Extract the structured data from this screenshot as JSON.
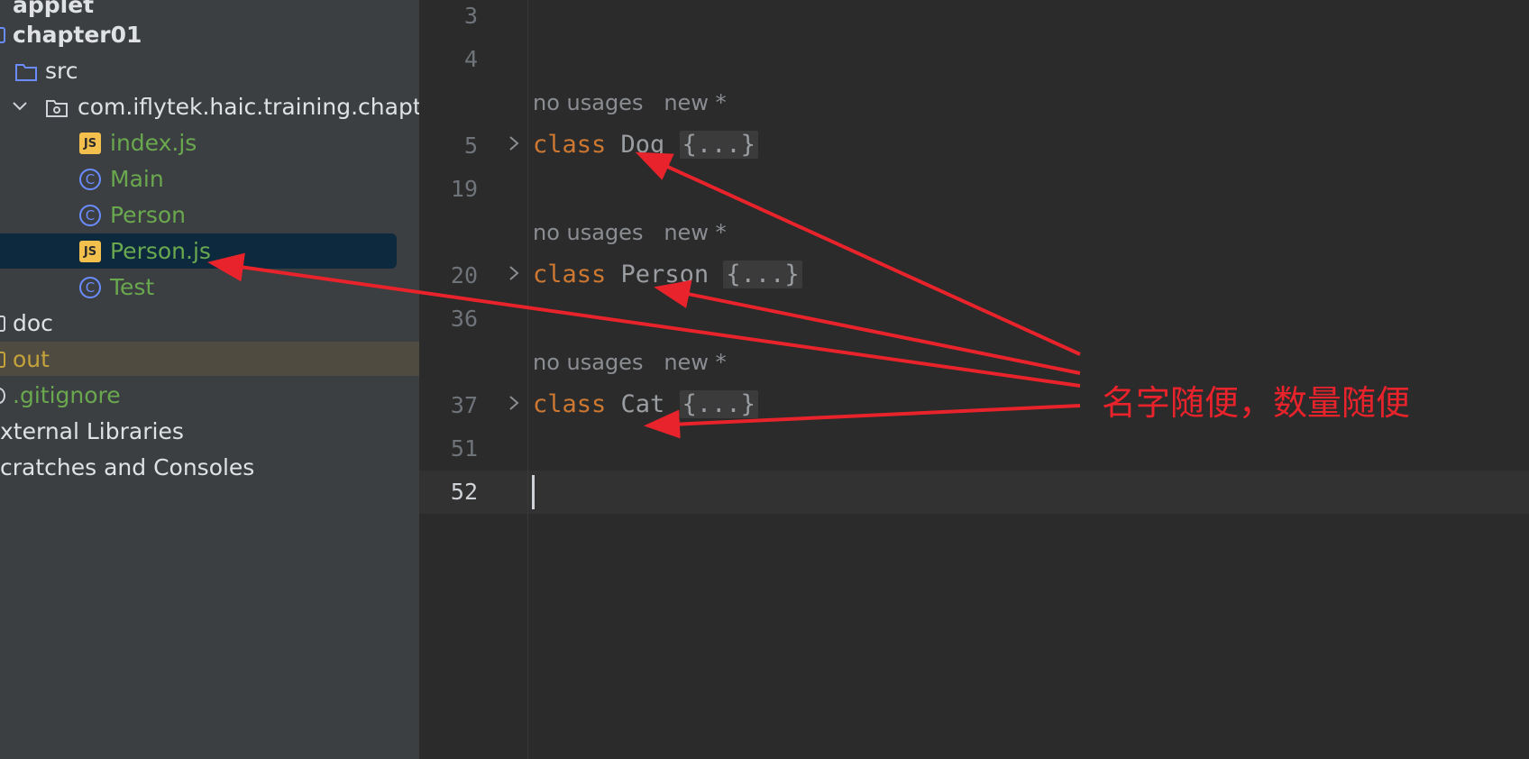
{
  "sidebar": {
    "applet": "applet",
    "chapter01": "chapter01",
    "src": "src",
    "package": "com.iflytek.haic.training.chapte",
    "files": {
      "index_js": "index.js",
      "main": "Main",
      "person": "Person",
      "person_js": "Person.js",
      "test": "Test"
    },
    "doc": "doc",
    "out": "out",
    "gitignore": ".gitignore",
    "external_libraries": "xternal Libraries",
    "scratches": "cratches and Consoles"
  },
  "editor": {
    "line_numbers": [
      "3",
      "4",
      "5",
      "19",
      "20",
      "36",
      "37",
      "51",
      "52"
    ],
    "hint_usages": "no usages",
    "hint_new": "new *",
    "keyword": "class",
    "fold_text": "{...}",
    "classes": [
      "Dog",
      "Person",
      "Cat"
    ]
  },
  "annotation": {
    "text": "名字随便，数量随便",
    "color": "#e8232b"
  },
  "colors": {
    "keyword": "#cc7832",
    "file_green": "#6aa84f",
    "selection": "#0d293e",
    "out_folder": "#c5a33b"
  }
}
